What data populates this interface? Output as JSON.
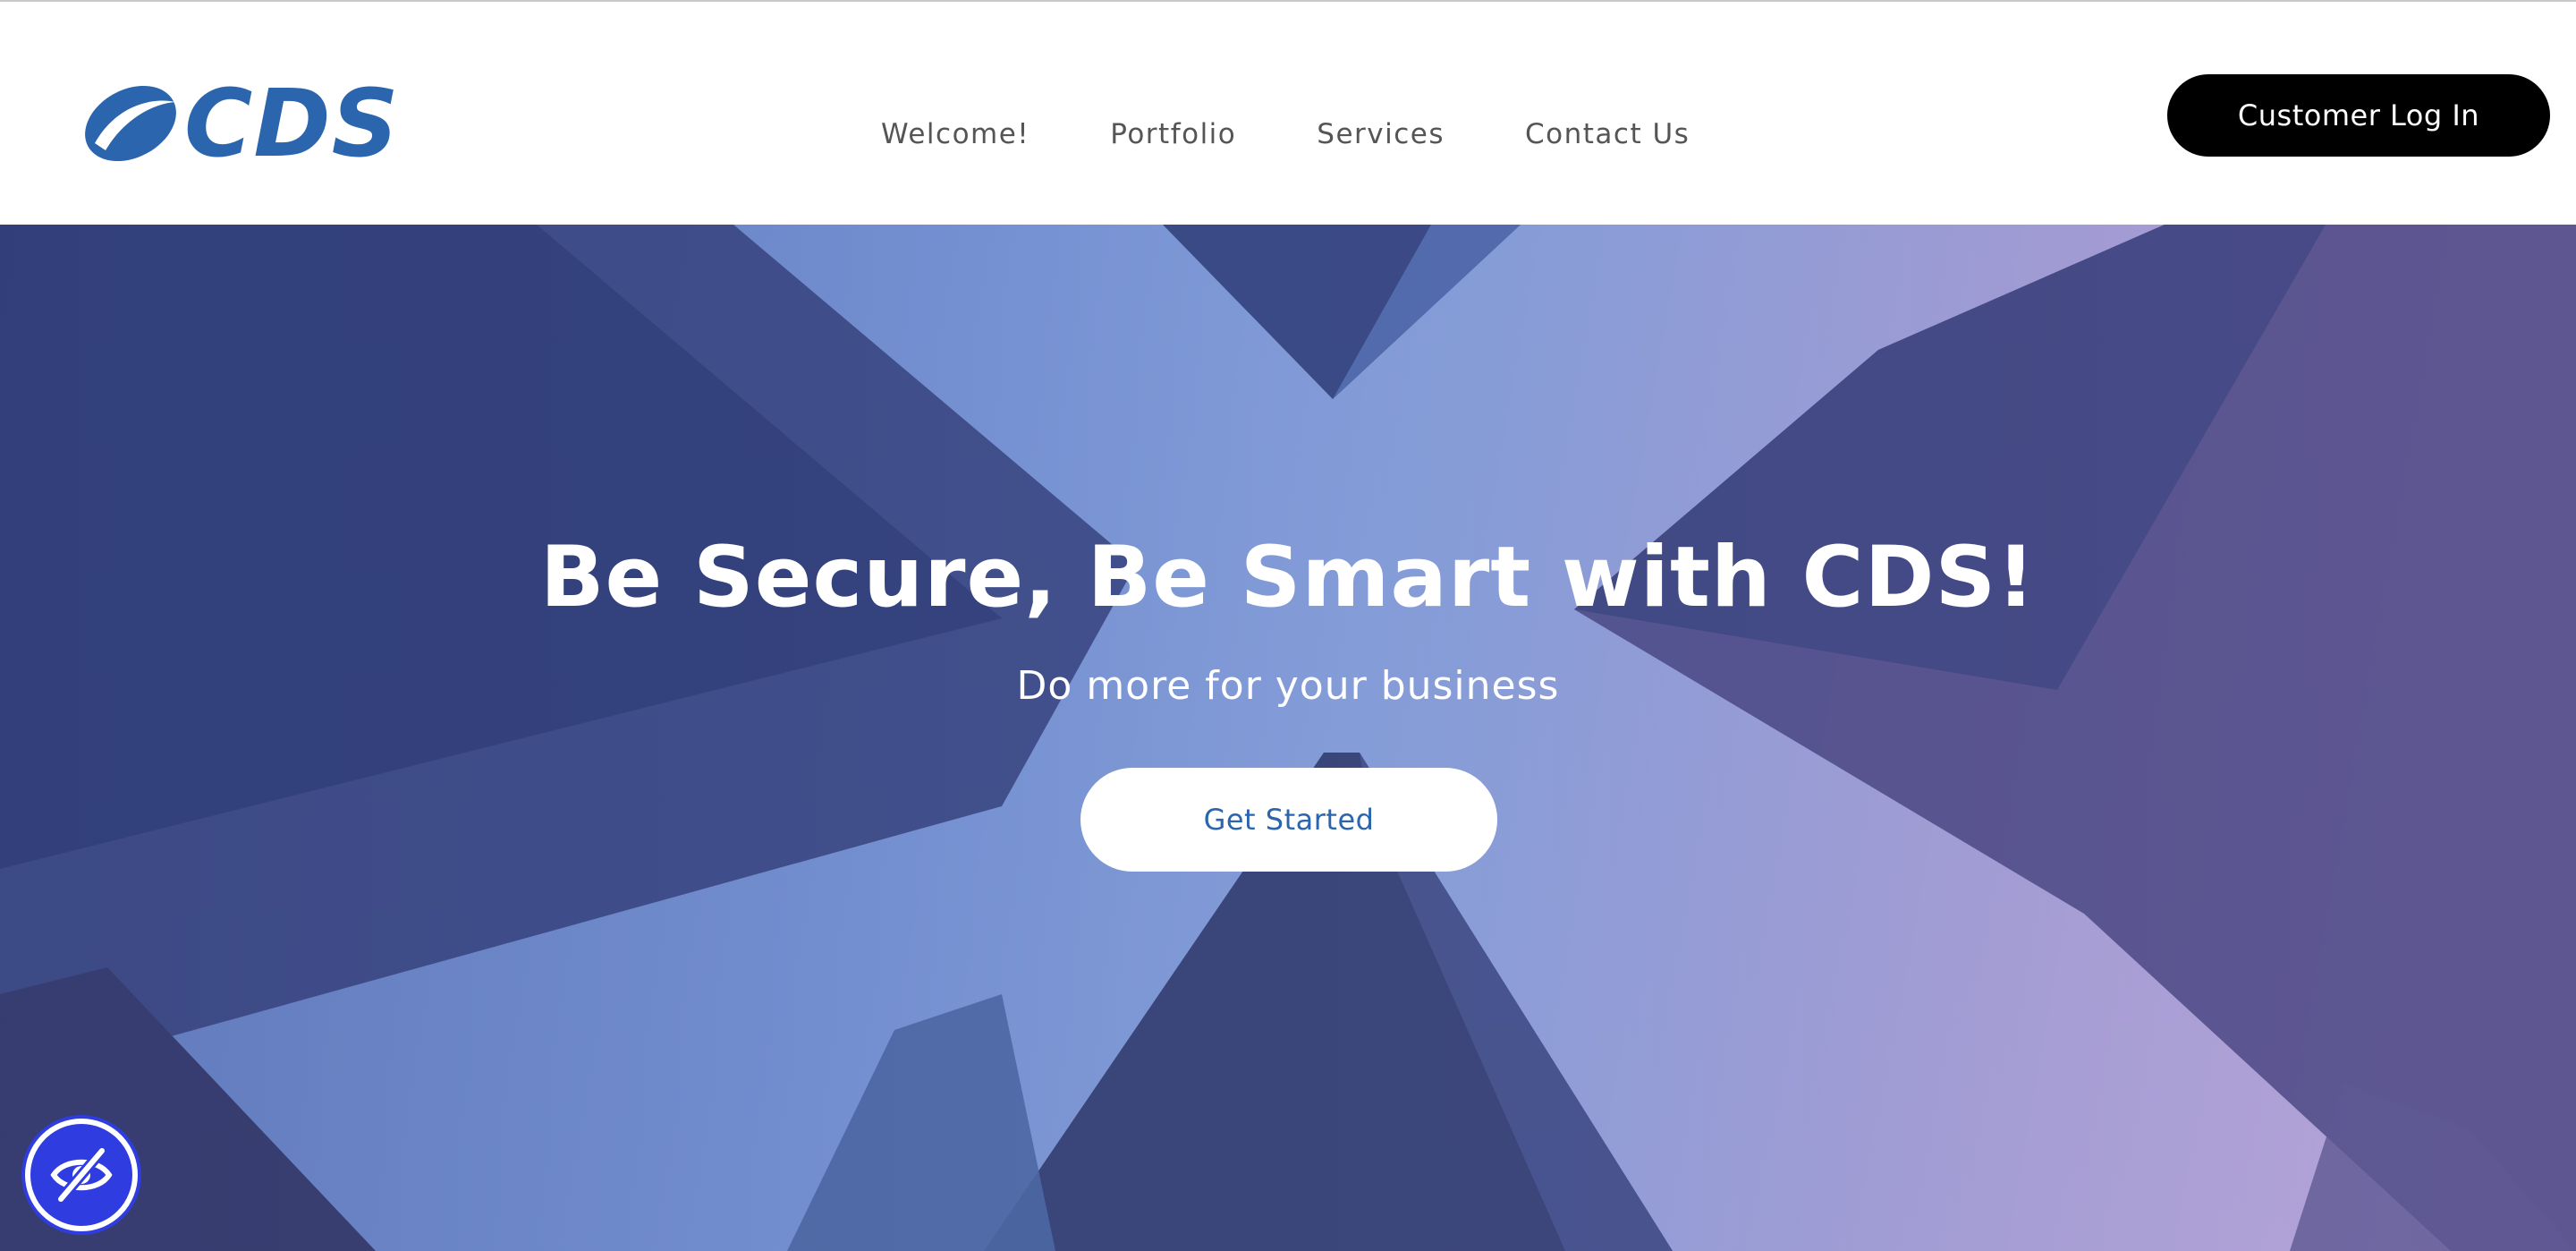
{
  "brand": {
    "name": "CDS",
    "color": "#2a65ad"
  },
  "nav": {
    "items": [
      {
        "label": "Welcome!"
      },
      {
        "label": "Portfolio"
      },
      {
        "label": "Services"
      },
      {
        "label": "Contact Us"
      }
    ]
  },
  "header": {
    "login_label": "Customer Log In"
  },
  "hero": {
    "title": "Be Secure, Be Smart with CDS!",
    "subtitle": "Do more for your business",
    "cta_label": "Get Started"
  },
  "accessibility": {
    "icon": "eye-slash-icon",
    "color": "#2f3de0"
  }
}
